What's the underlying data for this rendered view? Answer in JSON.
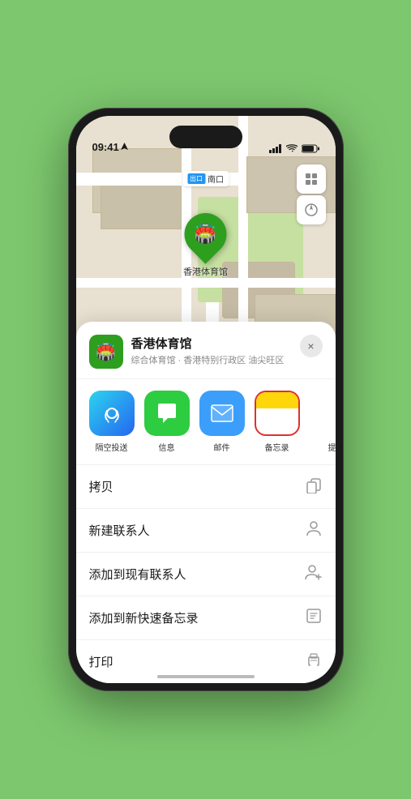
{
  "status_bar": {
    "time": "09:41",
    "location_arrow": true
  },
  "map": {
    "label_prefix": "南口",
    "venue_name": "香港体育馆",
    "venue_subtitle": "综合体育馆 · 香港特别行政区 油尖旺区"
  },
  "share_row": [
    {
      "id": "airdrop",
      "label": "隔空投送",
      "type": "airdrop"
    },
    {
      "id": "messages",
      "label": "信息",
      "type": "messages"
    },
    {
      "id": "mail",
      "label": "邮件",
      "type": "mail"
    },
    {
      "id": "notes",
      "label": "备忘录",
      "type": "notes",
      "highlighted": true
    },
    {
      "id": "more",
      "label": "提",
      "type": "more"
    }
  ],
  "actions": [
    {
      "id": "copy",
      "label": "拷贝",
      "icon": "copy"
    },
    {
      "id": "new-contact",
      "label": "新建联系人",
      "icon": "person"
    },
    {
      "id": "add-existing",
      "label": "添加到现有联系人",
      "icon": "person-add"
    },
    {
      "id": "add-note",
      "label": "添加到新快速备忘录",
      "icon": "note"
    },
    {
      "id": "print",
      "label": "打印",
      "icon": "print"
    }
  ],
  "close_label": "×"
}
